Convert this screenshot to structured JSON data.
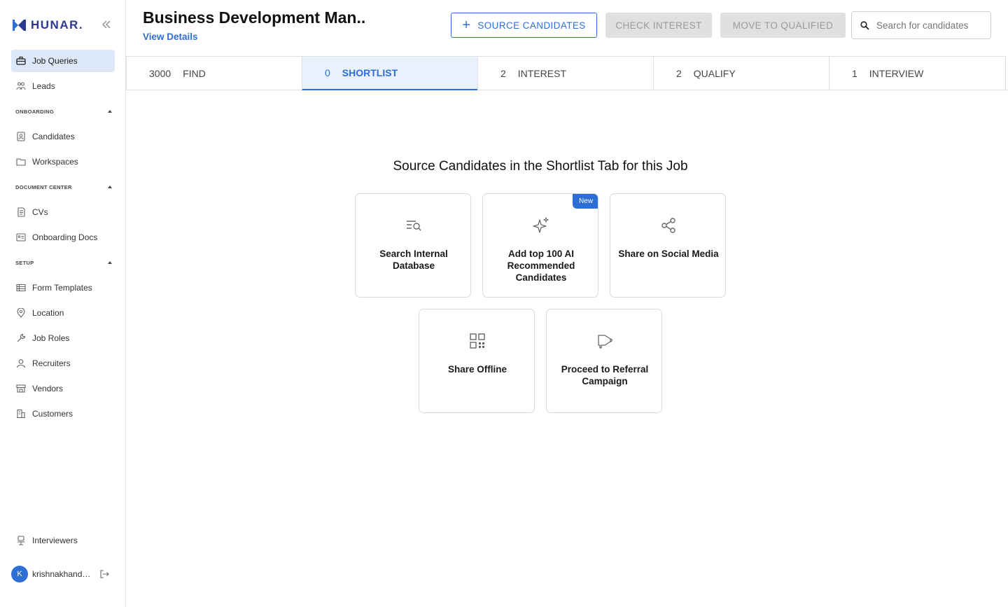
{
  "app": {
    "logo_text": "HUNAR."
  },
  "sidebar": {
    "top_items": [
      {
        "label": "Job Queries",
        "icon": "briefcase-icon",
        "active": true
      },
      {
        "label": "Leads",
        "icon": "people-icon"
      }
    ],
    "sections": [
      {
        "label": "ONBOARDING",
        "items": [
          {
            "label": "Candidates",
            "icon": "id-card-icon"
          },
          {
            "label": "Workspaces",
            "icon": "folder-icon"
          }
        ]
      },
      {
        "label": "DOCUMENT CENTER",
        "items": [
          {
            "label": "CVs",
            "icon": "document-icon"
          },
          {
            "label": "Onboarding Docs",
            "icon": "id-badge-icon"
          }
        ]
      },
      {
        "label": "SETUP",
        "items": [
          {
            "label": "Form Templates",
            "icon": "table-icon"
          },
          {
            "label": "Location",
            "icon": "location-pin-icon"
          },
          {
            "label": "Job Roles",
            "icon": "wrench-icon"
          },
          {
            "label": "Recruiters",
            "icon": "person-icon"
          },
          {
            "label": "Vendors",
            "icon": "store-icon"
          },
          {
            "label": "Customers",
            "icon": "building-icon"
          }
        ]
      }
    ],
    "bottom_item": {
      "label": "Interviewers",
      "icon": "chair-icon"
    },
    "user": {
      "initial": "K",
      "name": "krishnakhandel..."
    }
  },
  "header": {
    "job_title": "Business Development Man..",
    "view_details": "View Details",
    "source_button": "SOURCE CANDIDATES",
    "check_interest_button": "CHECK INTEREST",
    "move_button": "MOVE TO QUALIFIED",
    "search_placeholder": "Search for candidates"
  },
  "tabs": [
    {
      "count": "3000",
      "label": "FIND",
      "active": false
    },
    {
      "count": "0",
      "label": "SHORTLIST",
      "active": true
    },
    {
      "count": "2",
      "label": "INTEREST",
      "active": false
    },
    {
      "count": "2",
      "label": "QUALIFY",
      "active": false
    },
    {
      "count": "1",
      "label": "INTERVIEW",
      "active": false
    }
  ],
  "main": {
    "heading": "Source Candidates in the Shortlist Tab for this Job",
    "cards": [
      {
        "label": "Search Internal Database",
        "icon": "search-list-icon"
      },
      {
        "label": "Add top 100 AI Recommended Candidates",
        "icon": "sparkle-icon",
        "badge": "New"
      },
      {
        "label": "Share on Social Media",
        "icon": "share-icon"
      },
      {
        "label": "Share Offline",
        "icon": "qr-code-icon"
      },
      {
        "label": "Proceed to Referral Campaign",
        "icon": "megaphone-icon"
      }
    ]
  },
  "colors": {
    "accent": "#2e6fd6",
    "active_bg": "#dde8f9",
    "disabled_bg": "#e0e0e0"
  }
}
